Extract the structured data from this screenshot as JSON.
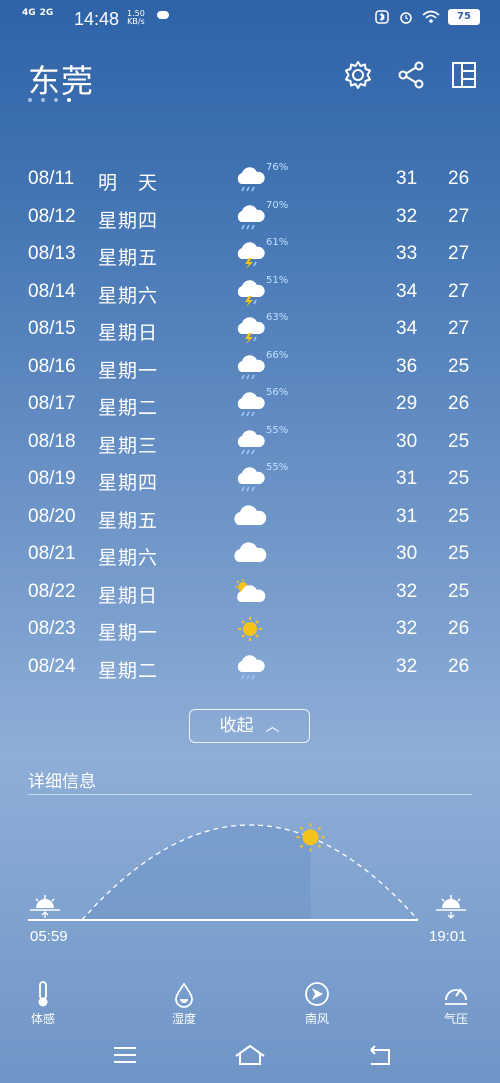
{
  "status_bar": {
    "net1": "4G",
    "net2": "2G",
    "time": "14:48",
    "speed_value": "1.50",
    "speed_unit": "KB/s",
    "battery": "75"
  },
  "header": {
    "city": "东莞",
    "page_dots": 4,
    "active_dot": 4
  },
  "forecast": [
    {
      "date": "08/11",
      "day": "明　天",
      "icon": "rain-cloud-icon",
      "pop": "76%",
      "high": "31",
      "low": "26"
    },
    {
      "date": "08/12",
      "day": "星期四",
      "icon": "rain-cloud-icon",
      "pop": "70%",
      "high": "32",
      "low": "27"
    },
    {
      "date": "08/13",
      "day": "星期五",
      "icon": "thunderstorm-icon",
      "pop": "61%",
      "high": "33",
      "low": "27"
    },
    {
      "date": "08/14",
      "day": "星期六",
      "icon": "thunderstorm-icon",
      "pop": "51%",
      "high": "34",
      "low": "27"
    },
    {
      "date": "08/15",
      "day": "星期日",
      "icon": "thunderstorm-icon",
      "pop": "63%",
      "high": "34",
      "low": "27"
    },
    {
      "date": "08/16",
      "day": "星期一",
      "icon": "rain-cloud-icon",
      "pop": "66%",
      "high": "36",
      "low": "25"
    },
    {
      "date": "08/17",
      "day": "星期二",
      "icon": "rain-cloud-icon",
      "pop": "56%",
      "high": "29",
      "low": "26"
    },
    {
      "date": "08/18",
      "day": "星期三",
      "icon": "rain-cloud-icon",
      "pop": "55%",
      "high": "30",
      "low": "25"
    },
    {
      "date": "08/19",
      "day": "星期四",
      "icon": "rain-cloud-icon",
      "pop": "55%",
      "high": "31",
      "low": "25"
    },
    {
      "date": "08/20",
      "day": "星期五",
      "icon": "cloud-icon",
      "pop": "",
      "high": "31",
      "low": "25"
    },
    {
      "date": "08/21",
      "day": "星期六",
      "icon": "cloud-icon",
      "pop": "",
      "high": "30",
      "low": "25"
    },
    {
      "date": "08/22",
      "day": "星期日",
      "icon": "partly-cloudy-icon",
      "pop": "",
      "high": "32",
      "low": "25"
    },
    {
      "date": "08/23",
      "day": "星期一",
      "icon": "sun-icon",
      "pop": "",
      "high": "32",
      "low": "26"
    },
    {
      "date": "08/24",
      "day": "星期二",
      "icon": "rain-cloud-icon",
      "pop": "",
      "high": "32",
      "low": "26"
    }
  ],
  "collapse_label": "收起",
  "details": {
    "title": "详细信息",
    "sunrise": "05:59",
    "sunset": "19:01",
    "sun_progress": 0.68
  },
  "metrics": [
    {
      "label": "体感",
      "icon": "thermometer-icon"
    },
    {
      "label": "湿度",
      "icon": "humidity-drop-icon"
    },
    {
      "label": "南风",
      "icon": "wind-direction-icon"
    },
    {
      "label": "气压",
      "icon": "pressure-gauge-icon"
    }
  ],
  "colors": {
    "bg_top": "#2f63a8",
    "bg_mid": "#8eaed6",
    "pop_text": "#bfe0ff",
    "sun": "#f5c31c"
  }
}
